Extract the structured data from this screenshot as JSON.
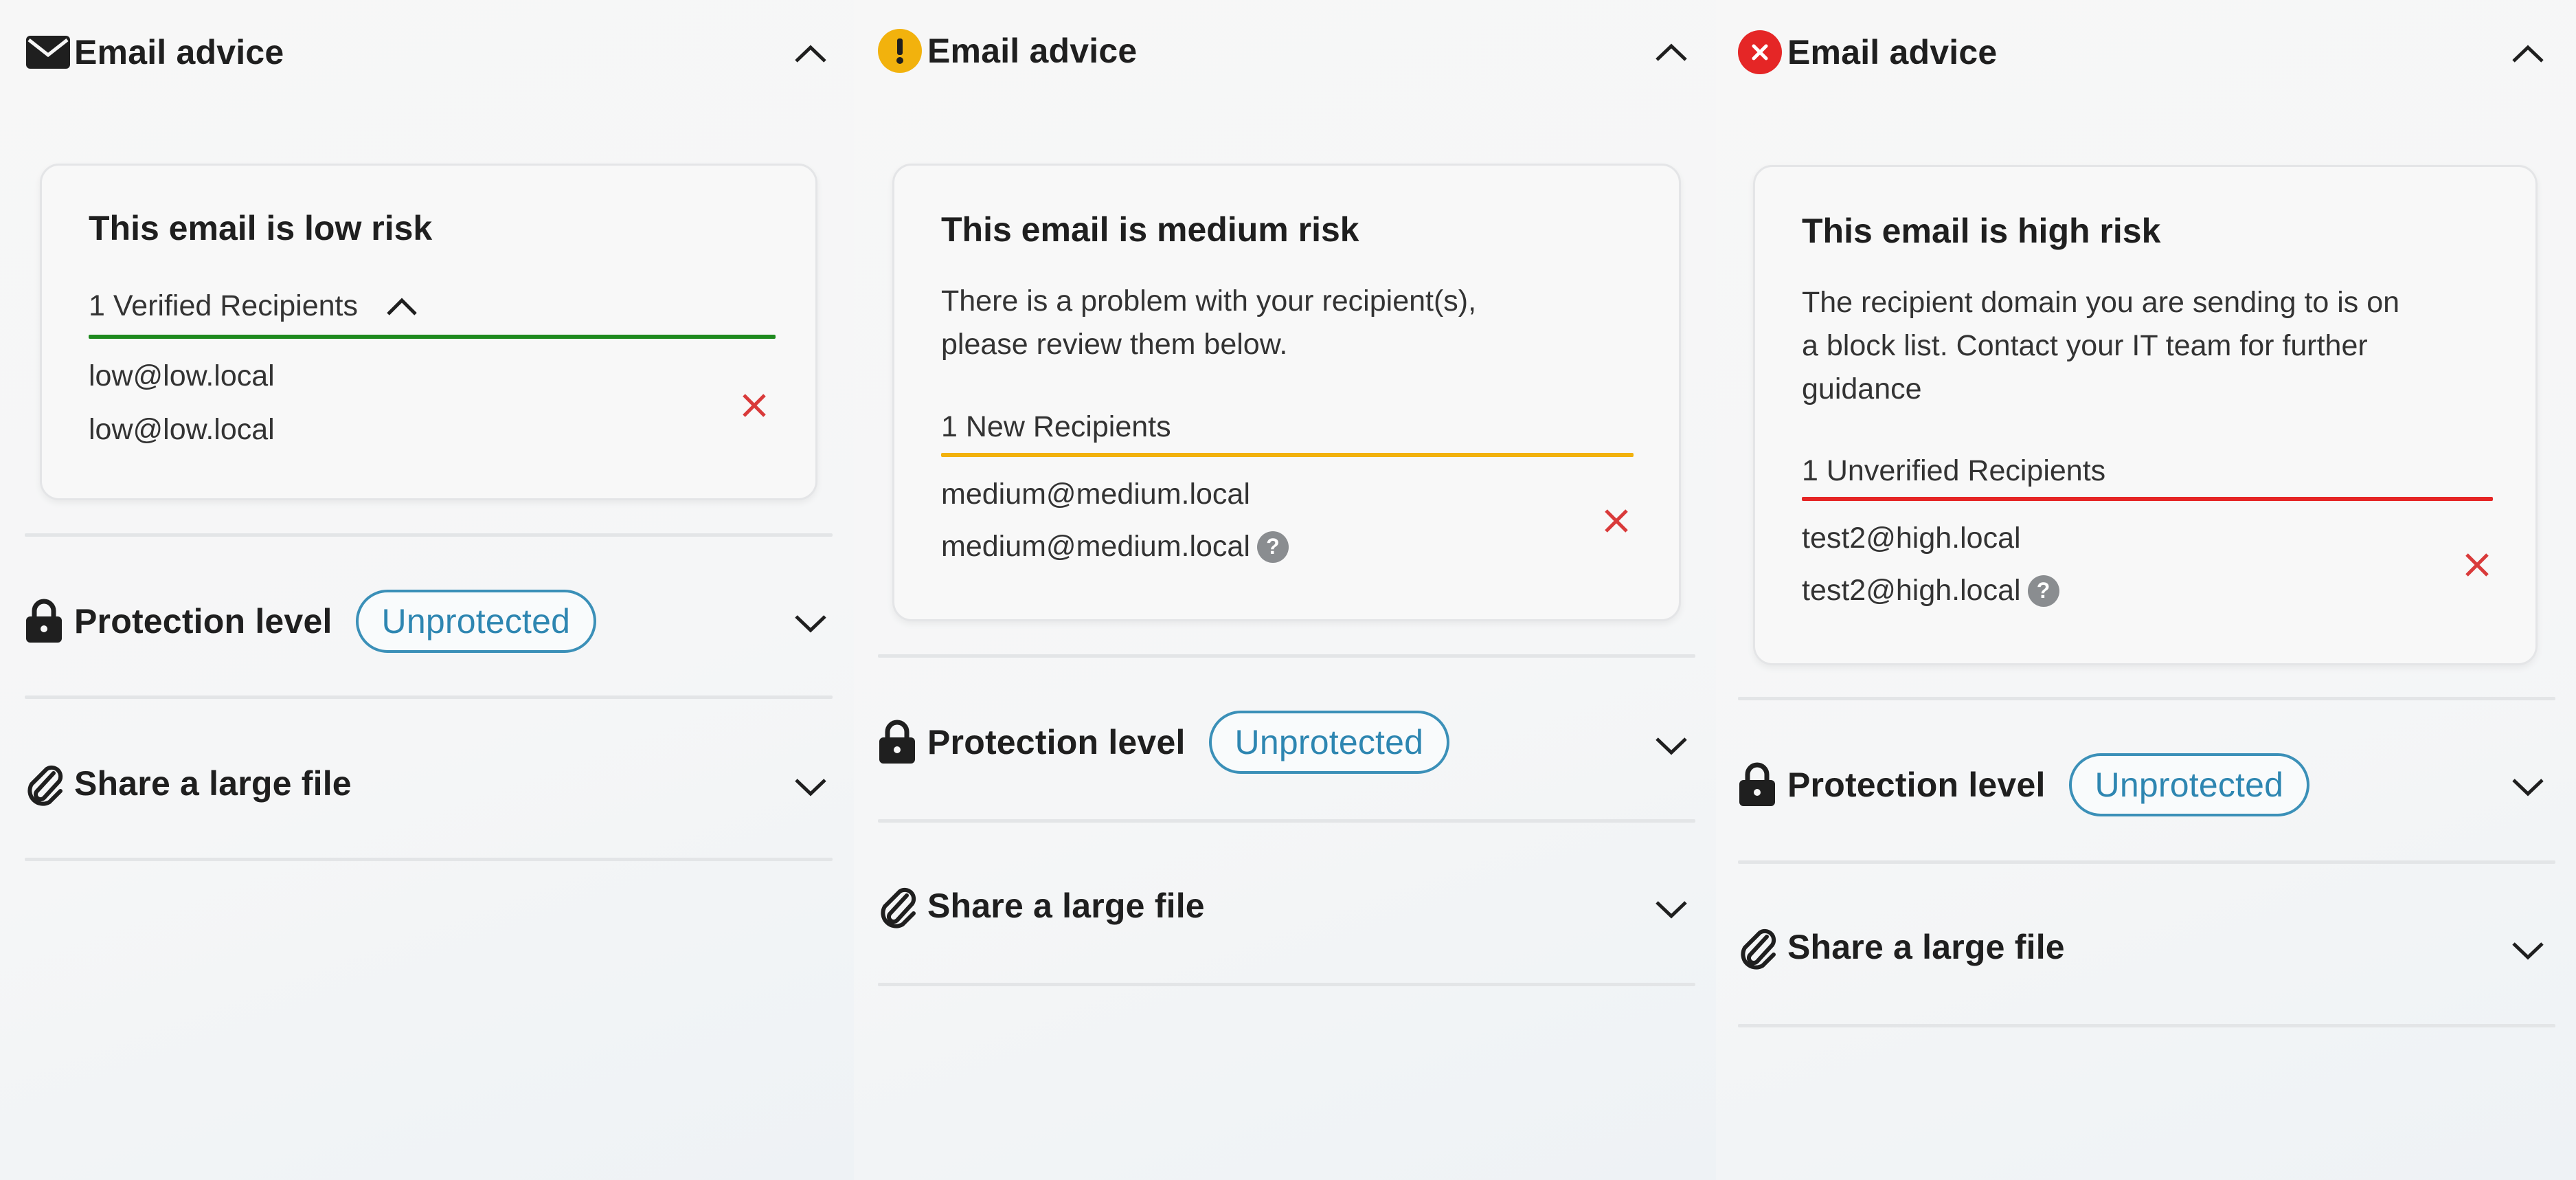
{
  "colors": {
    "low": "#1e8a1e",
    "medium": "#f2b20d",
    "high": "#e52626",
    "remove": "#d93a3a",
    "badge": "#3b90b8"
  },
  "panels": [
    {
      "status_icon": "envelope-icon",
      "header": "Email advice",
      "title": "This email is low risk",
      "description": "",
      "recipients_header": "1 Verified Recipients",
      "emails": [
        "low@low.local",
        "low@low.local"
      ],
      "protection_label": "Protection level",
      "protection_badge": "Unprotected",
      "share_label": "Share a large file"
    },
    {
      "status_icon": "warning-icon",
      "header": "Email advice",
      "title": "This email is medium risk",
      "description_lines": [
        "There is a problem with your recipient(s),",
        "please review them below."
      ],
      "recipients_header": "1 New Recipients",
      "emails": [
        "medium@medium.local",
        "medium@medium.local"
      ],
      "protection_label": "Protection level",
      "protection_badge": "Unprotected",
      "share_label": "Share a large file"
    },
    {
      "status_icon": "error-icon",
      "header": "Email advice",
      "title": "This email is high risk",
      "description_lines": [
        "The recipient domain you are sending to is on",
        "a block list. Contact your IT team for further",
        "guidance"
      ],
      "recipients_header": "1 Unverified Recipients",
      "emails": [
        "test2@high.local",
        "test2@high.local"
      ],
      "protection_label": "Protection level",
      "protection_badge": "Unprotected",
      "share_label": "Share a large file"
    }
  ]
}
